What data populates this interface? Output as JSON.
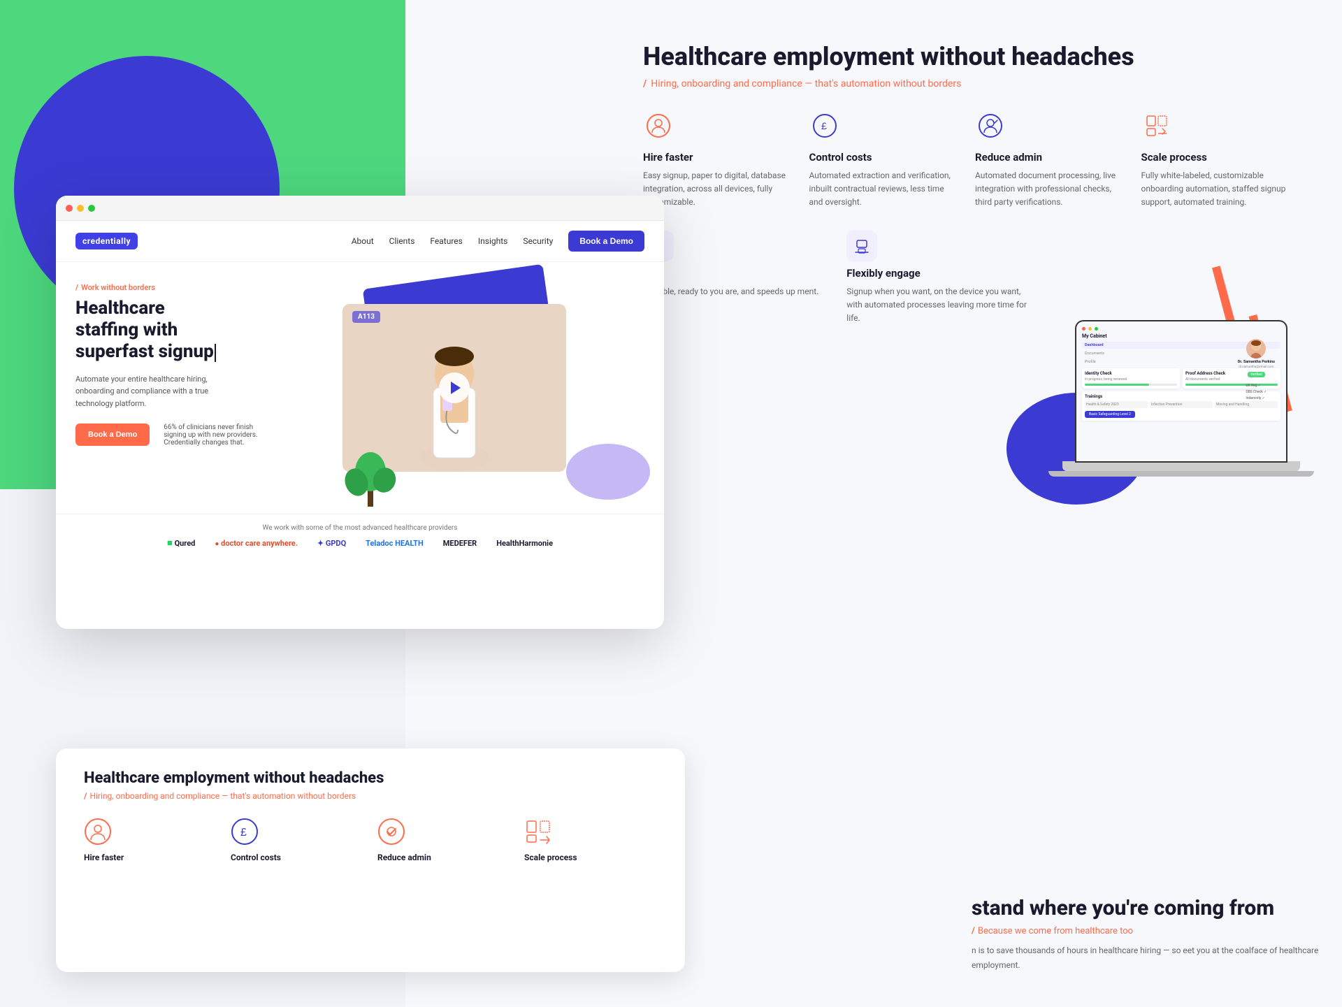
{
  "brand": {
    "name": "credentially",
    "logo_label": "credentially"
  },
  "nav": {
    "links": [
      "About",
      "Clients",
      "Features",
      "Insights",
      "Security"
    ],
    "cta": "Book a Demo"
  },
  "hero": {
    "tag": "Work without borders",
    "title_line1": "Healthcare",
    "title_line2": "staffing with",
    "title_line3": "superfast signup",
    "description": "Automate your entire healthcare hiring, onboarding and compliance with a true technology platform.",
    "cta": "Book a Demo",
    "stat": "66% of clinicians never finish signing up with new providers. Credentially changes that."
  },
  "partners": {
    "label": "We work with some of the most advanced healthcare providers",
    "logos": [
      "Qured",
      "doctor care anywhere.",
      "GPDQ",
      "Teladoc HEALTH",
      "MEDEFER",
      "HealthHarmonie"
    ]
  },
  "features_section": {
    "title": "Healthcare employment without headaches",
    "subtitle": "Hiring, onboarding and compliance — that's automation without borders",
    "items": [
      {
        "name": "Hire faster",
        "desc": "Easy signup, paper to digital, database integration, across all devices, fully customizable.",
        "icon": "user"
      },
      {
        "name": "Control costs",
        "desc": "Automated extraction and verification, inbuilt contractual reviews, less time and oversight.",
        "icon": "pound"
      },
      {
        "name": "Reduce admin",
        "desc": "Automated document processing, live integration with professional checks, third party verifications.",
        "icon": "user-check"
      },
      {
        "name": "Scale process",
        "desc": "Fully white-labeled, customizable onboarding automation, staffed signup support, automated training.",
        "icon": "scale"
      }
    ]
  },
  "engage_section": {
    "items": [
      {
        "name": "Flexibly engage",
        "desc": "Signup when you want, on the device you want, with automated processes leaving more time for life."
      }
    ]
  },
  "stand_section": {
    "title": "stand where you're coming from",
    "subtitle": "Because we come from healthcare too",
    "desc": "n is to save thousands of hours in healthcare hiring — so\neet you at the coalface of healthcare employment."
  },
  "video": {
    "badge": "A113"
  },
  "dashboard": {
    "title": "My Cabinet",
    "sections": [
      "Identity Check",
      "Proof Address Check",
      "Trainings"
    ],
    "name": "Dr. Samantha Perkins",
    "email": "dr.samantha@email.com"
  },
  "bottom_section": {
    "title": "Healthcare employment without headaches",
    "subtitle": "Hiring, onboarding and compliance — that's automation without borders",
    "items": [
      "Hire faster",
      "Control costs",
      "Reduce admin",
      "Scale process"
    ]
  },
  "colors": {
    "brand_blue": "#3b3bd4",
    "brand_green": "#4dd87e",
    "brand_orange": "#ff6b4a",
    "dark": "#1a1a2e",
    "light_purple": "#c5b8f5"
  }
}
